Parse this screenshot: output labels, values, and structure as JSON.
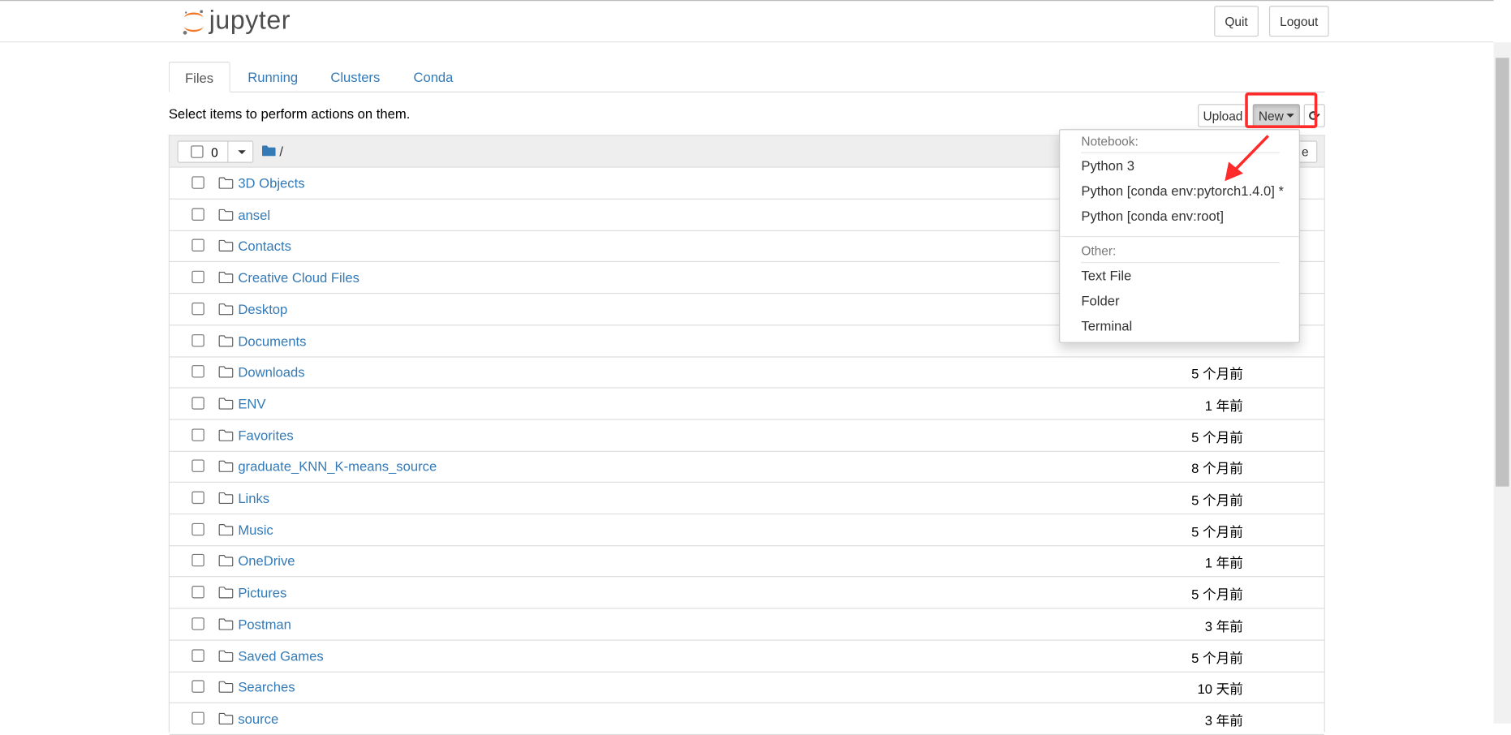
{
  "header": {
    "logo_text": "jupyter",
    "quit": "Quit",
    "logout": "Logout"
  },
  "tabs": [
    {
      "label": "Files",
      "active": true
    },
    {
      "label": "Running"
    },
    {
      "label": "Clusters"
    },
    {
      "label": "Conda"
    }
  ],
  "toolbar": {
    "hint": "Select items to perform actions on them.",
    "upload": "Upload",
    "new": "New",
    "selected_count": "0",
    "path": "/",
    "partial_button": "e"
  },
  "new_menu": {
    "notebook_header": "Notebook:",
    "notebook_items": [
      "Python 3",
      "Python [conda env:pytorch1.4.0] *",
      "Python [conda env:root]"
    ],
    "other_header": "Other:",
    "other_items": [
      "Text File",
      "Folder",
      "Terminal"
    ]
  },
  "annotation": {
    "color": "#ff2a2a"
  },
  "files": [
    {
      "name": "3D Objects",
      "date": ""
    },
    {
      "name": "ansel",
      "date": ""
    },
    {
      "name": "Contacts",
      "date": ""
    },
    {
      "name": "Creative Cloud Files",
      "date": ""
    },
    {
      "name": "Desktop",
      "date": ""
    },
    {
      "name": "Documents",
      "date": ""
    },
    {
      "name": "Downloads",
      "date": "5 个月前"
    },
    {
      "name": "ENV",
      "date": "1 年前"
    },
    {
      "name": "Favorites",
      "date": "5 个月前"
    },
    {
      "name": "graduate_KNN_K-means_source",
      "date": "8 个月前"
    },
    {
      "name": "Links",
      "date": "5 个月前"
    },
    {
      "name": "Music",
      "date": "5 个月前"
    },
    {
      "name": "OneDrive",
      "date": "1 年前"
    },
    {
      "name": "Pictures",
      "date": "5 个月前"
    },
    {
      "name": "Postman",
      "date": "3 年前"
    },
    {
      "name": "Saved Games",
      "date": "5 个月前"
    },
    {
      "name": "Searches",
      "date": "10 天前"
    },
    {
      "name": "source",
      "date": "3 年前"
    }
  ]
}
